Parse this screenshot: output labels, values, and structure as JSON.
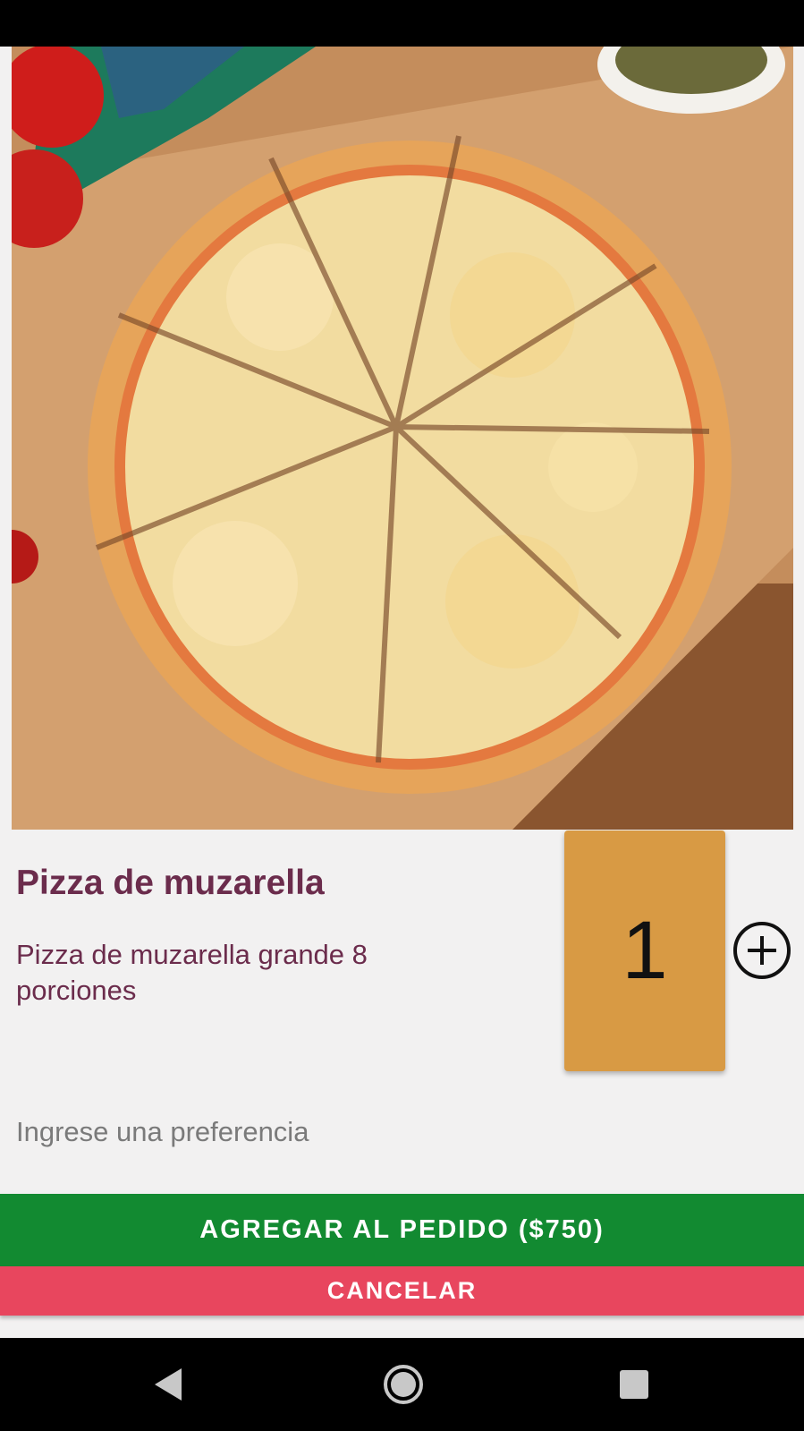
{
  "product": {
    "name": "Pizza de muzarella",
    "description": "Pizza de muzarella grande 8 porciones",
    "image_icon": "pizza-photo"
  },
  "quantity": {
    "value": "1",
    "increment_icon": "plus-circle-icon"
  },
  "preference": {
    "placeholder": "Ingrese una preferencia",
    "value": ""
  },
  "actions": {
    "add_label": "AGREGAR AL PEDIDO ($750)",
    "cancel_label": "CANCELAR"
  },
  "navigation": {
    "back_icon": "back-triangle-icon",
    "home_icon": "home-circle-icon",
    "recents_icon": "recents-square-icon"
  },
  "colors": {
    "title": "#6b2c4c",
    "quantity_box": "#d89a44",
    "add_button": "#128a31",
    "cancel_button": "#e8465e",
    "background": "#f2f1f1"
  }
}
